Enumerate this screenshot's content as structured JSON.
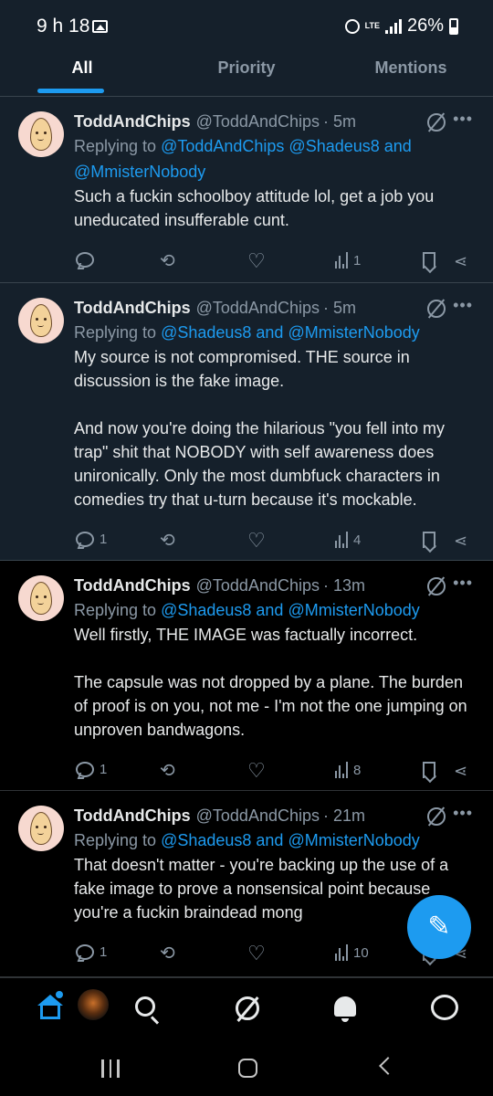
{
  "status_bar": {
    "time": "9 h 18",
    "network": "LTE",
    "battery": "26%"
  },
  "tabs": [
    {
      "label": "All",
      "active": true
    },
    {
      "label": "Priority",
      "active": false
    },
    {
      "label": "Mentions",
      "active": false
    }
  ],
  "tweets": [
    {
      "name": "ToddAndChips",
      "handle": "@ToddAndChips",
      "time": "· 5m",
      "replying_prefix": "Replying to ",
      "replying_to": "@ToddAndChips @Shadeus8 and @MmisterNobody",
      "paragraphs": [
        "Such a fuckin schoolboy attitude lol, get a job you uneducated insufferable cunt."
      ],
      "replies": "",
      "retweets": "",
      "likes": "",
      "views": "1"
    },
    {
      "name": "ToddAndChips",
      "handle": "@ToddAndChips",
      "time": "· 5m",
      "replying_prefix": "Replying to ",
      "replying_to": "@Shadeus8 and @MmisterNobody",
      "paragraphs": [
        "My source is not compromised. THE source in discussion is the fake image.",
        "And now you're doing the hilarious \"you fell into my trap\" shit that NOBODY with self awareness does unironically. Only the most dumbfuck characters in comedies try that u-turn because it's mockable."
      ],
      "replies": "1",
      "retweets": "",
      "likes": "",
      "views": "4"
    },
    {
      "name": "ToddAndChips",
      "handle": "@ToddAndChips",
      "time": "· 13m",
      "replying_prefix": "Replying to ",
      "replying_to": "@Shadeus8 and @MmisterNobody",
      "paragraphs": [
        "Well firstly, THE IMAGE was factually incorrect.",
        "The capsule was not dropped by a plane. The burden of proof is on you, not me - I'm not the one jumping on unproven bandwagons."
      ],
      "replies": "1",
      "retweets": "",
      "likes": "",
      "views": "8"
    },
    {
      "name": "ToddAndChips",
      "handle": "@ToddAndChips",
      "time": "· 21m",
      "replying_prefix": "Replying to ",
      "replying_to": "@Shadeus8 and @MmisterNobody",
      "paragraphs": [
        "That doesn't matter - you're backing up the use of a fake image to prove a nonsensical point because you're a fuckin braindead mong"
      ],
      "replies": "1",
      "retweets": "",
      "likes": "",
      "views": "10"
    }
  ],
  "icons": {
    "accent": "#1d9bf0",
    "compose": "feather-plus-icon",
    "nav": [
      "home-icon",
      "avatar",
      "search-icon",
      "grok-icon",
      "bell-icon",
      "messages-icon"
    ]
  }
}
